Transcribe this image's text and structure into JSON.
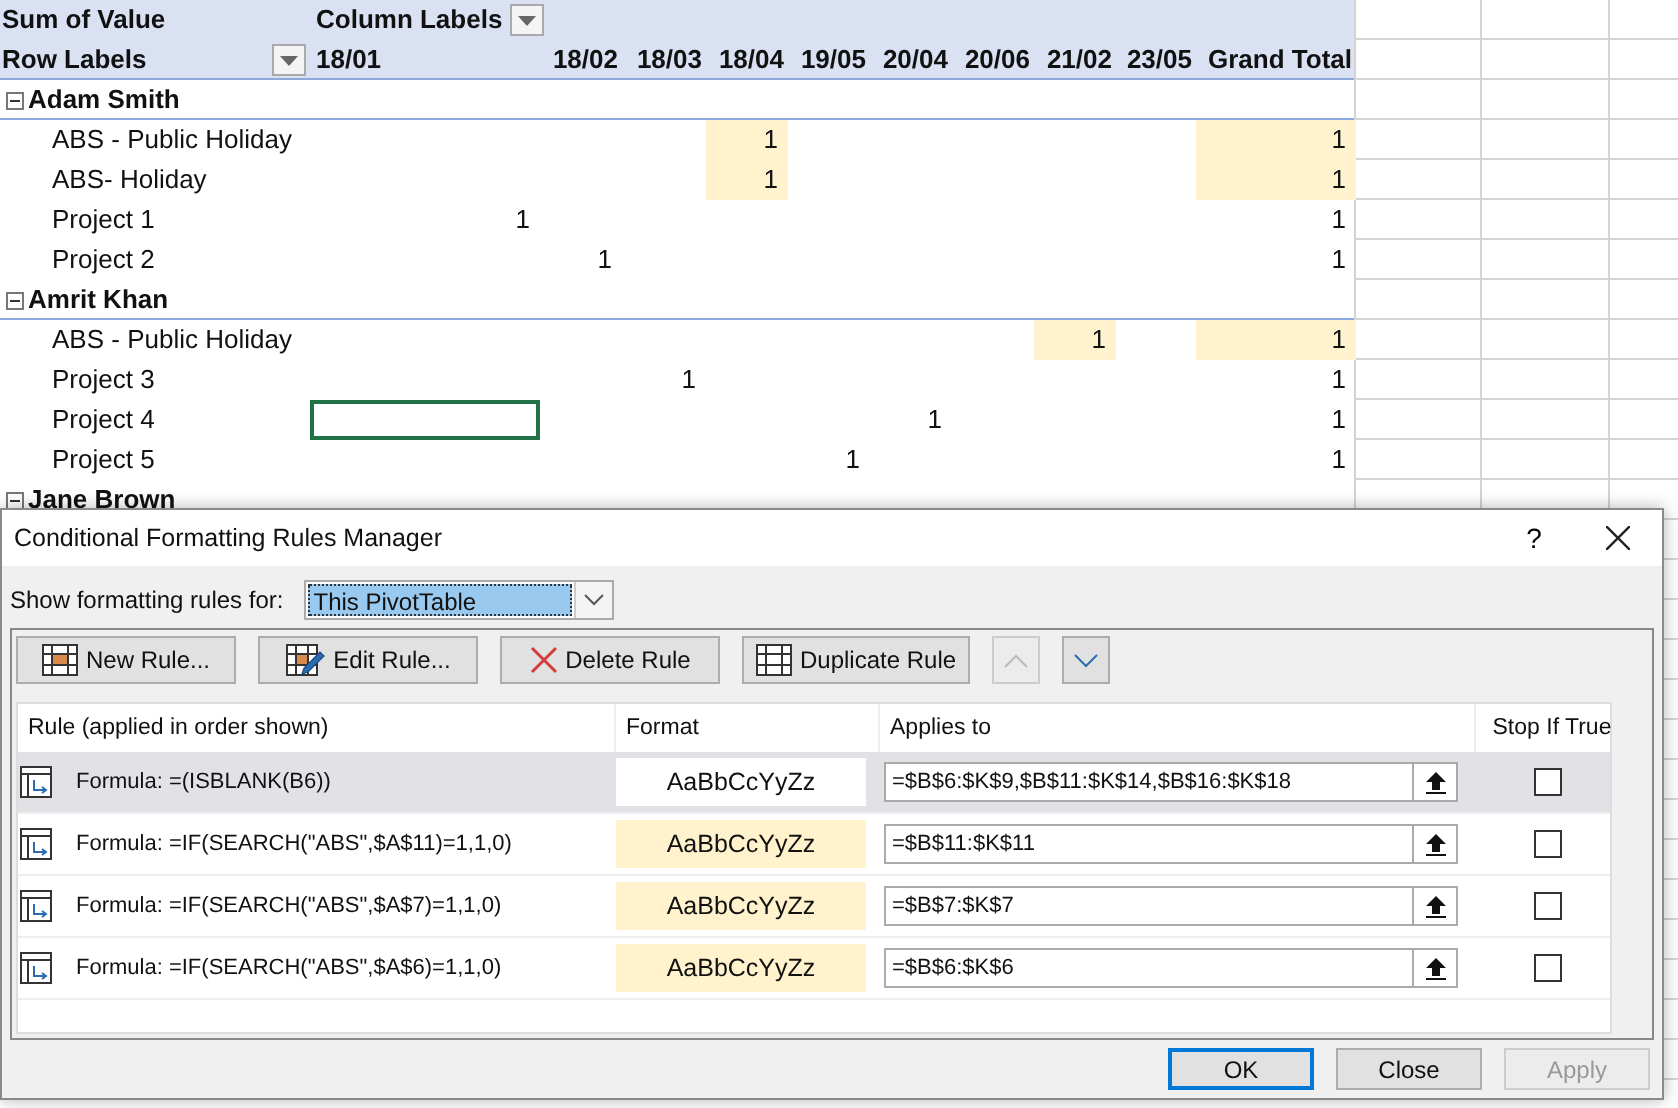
{
  "pivot": {
    "value_label": "Sum of Value",
    "column_labels": "Column Labels",
    "row_labels": "Row Labels",
    "columns": [
      "18/01",
      "18/02",
      "18/03",
      "18/04",
      "19/05",
      "20/04",
      "20/06",
      "21/02",
      "23/05",
      "Grand Total"
    ],
    "groups": [
      {
        "name": "Adam Smith",
        "expanded": true,
        "rows": [
          {
            "label": "ABS - Public Holiday",
            "cells": [
              {
                "selected": false,
                "highlighted": false
              },
              {
                "selected": false,
                "highlighted": false
              },
              {
                "selected": false,
                "highlighted": false
              },
              {
                "value": "1",
                "selected": false,
                "highlighted": true
              },
              {
                "selected": false,
                "highlighted": false
              },
              {
                "selected": false,
                "highlighted": false
              },
              {
                "selected": false,
                "highlighted": false
              },
              {
                "selected": false,
                "highlighted": false
              },
              {
                "selected": false,
                "highlighted": false
              },
              {
                "value": "1",
                "selected": false,
                "highlighted": true
              }
            ]
          },
          {
            "label": "ABS- Holiday",
            "cells": [
              {
                "selected": false,
                "highlighted": false
              },
              {
                "selected": false,
                "highlighted": false
              },
              {
                "selected": false,
                "highlighted": false
              },
              {
                "value": "1",
                "selected": false,
                "highlighted": true
              },
              {
                "selected": false,
                "highlighted": false
              },
              {
                "selected": false,
                "highlighted": false
              },
              {
                "selected": false,
                "highlighted": false
              },
              {
                "selected": false,
                "highlighted": false
              },
              {
                "selected": false,
                "highlighted": false
              },
              {
                "value": "1",
                "selected": false,
                "highlighted": true
              }
            ]
          },
          {
            "label": "Project 1",
            "cells": [
              {
                "value": "1",
                "selected": false,
                "highlighted": false
              },
              {
                "selected": false,
                "highlighted": false
              },
              {
                "selected": false,
                "highlighted": false
              },
              {
                "selected": false,
                "highlighted": false
              },
              {
                "selected": false,
                "highlighted": false
              },
              {
                "selected": false,
                "highlighted": false
              },
              {
                "selected": false,
                "highlighted": false
              },
              {
                "selected": false,
                "highlighted": false
              },
              {
                "selected": false,
                "highlighted": false
              },
              {
                "value": "1",
                "selected": false,
                "highlighted": false
              }
            ]
          },
          {
            "label": "Project 2",
            "cells": [
              {
                "selected": false,
                "highlighted": false
              },
              {
                "value": "1",
                "selected": false,
                "highlighted": false
              },
              {
                "selected": false,
                "highlighted": false
              },
              {
                "selected": false,
                "highlighted": false
              },
              {
                "selected": false,
                "highlighted": false
              },
              {
                "selected": false,
                "highlighted": false
              },
              {
                "selected": false,
                "highlighted": false
              },
              {
                "selected": false,
                "highlighted": false
              },
              {
                "selected": false,
                "highlighted": false
              },
              {
                "value": "1",
                "selected": false,
                "highlighted": false
              }
            ]
          }
        ]
      },
      {
        "name": "Amrit Khan",
        "expanded": true,
        "rows": [
          {
            "label": "ABS - Public Holiday",
            "cells": [
              {
                "selected": false,
                "highlighted": false
              },
              {
                "selected": false,
                "highlighted": false
              },
              {
                "selected": false,
                "highlighted": false
              },
              {
                "selected": false,
                "highlighted": false
              },
              {
                "selected": false,
                "highlighted": false
              },
              {
                "selected": false,
                "highlighted": false
              },
              {
                "selected": false,
                "highlighted": false
              },
              {
                "value": "1",
                "selected": false,
                "highlighted": true
              },
              {
                "selected": false,
                "highlighted": false
              },
              {
                "value": "1",
                "selected": false,
                "highlighted": true
              }
            ]
          },
          {
            "label": "Project 3",
            "cells": [
              {
                "selected": false,
                "highlighted": false
              },
              {
                "selected": false,
                "highlighted": false
              },
              {
                "value": "1",
                "selected": false,
                "highlighted": false
              },
              {
                "selected": false,
                "highlighted": false
              },
              {
                "selected": false,
                "highlighted": false
              },
              {
                "selected": false,
                "highlighted": false
              },
              {
                "selected": false,
                "highlighted": false
              },
              {
                "selected": false,
                "highlighted": false
              },
              {
                "selected": false,
                "highlighted": false
              },
              {
                "value": "1",
                "selected": false,
                "highlighted": false
              }
            ]
          },
          {
            "label": "Project 4",
            "cells": [
              {
                "selected": true,
                "highlighted": false
              },
              {
                "selected": false,
                "highlighted": false
              },
              {
                "selected": false,
                "highlighted": false
              },
              {
                "selected": false,
                "highlighted": false
              },
              {
                "selected": false,
                "highlighted": false
              },
              {
                "value": "1",
                "selected": false,
                "highlighted": false
              },
              {
                "selected": false,
                "highlighted": false
              },
              {
                "selected": false,
                "highlighted": false
              },
              {
                "selected": false,
                "highlighted": false
              },
              {
                "value": "1",
                "selected": false,
                "highlighted": false
              }
            ]
          },
          {
            "label": "Project 5",
            "cells": [
              {
                "selected": false,
                "highlighted": false
              },
              {
                "selected": false,
                "highlighted": false
              },
              {
                "selected": false,
                "highlighted": false
              },
              {
                "selected": false,
                "highlighted": false
              },
              {
                "value": "1",
                "selected": false,
                "highlighted": false
              },
              {
                "selected": false,
                "highlighted": false
              },
              {
                "selected": false,
                "highlighted": false
              },
              {
                "selected": false,
                "highlighted": false
              },
              {
                "selected": false,
                "highlighted": false
              },
              {
                "value": "1",
                "selected": false,
                "highlighted": false
              }
            ]
          }
        ]
      },
      {
        "name": "Jane Brown",
        "expanded": true
      }
    ]
  },
  "dialog": {
    "title": "Conditional Formatting Rules Manager",
    "help": "?",
    "show_for_label": "Show formatting rules for:",
    "show_for_value": "This PivotTable",
    "toolbar": [
      {
        "kind": "new",
        "label": "New Rule...",
        "disabled": false
      },
      {
        "kind": "edit",
        "label": "Edit Rule...",
        "disabled": false
      },
      {
        "kind": "delete",
        "label": "Delete Rule",
        "disabled": false
      },
      {
        "kind": "duplicate",
        "label": "Duplicate Rule",
        "disabled": false
      },
      {
        "kind": "up",
        "disabled": true
      },
      {
        "kind": "down",
        "disabled": false
      }
    ],
    "columns": [
      "Rule (applied in order shown)",
      "Format",
      "Applies to",
      "Stop If True"
    ],
    "rules": [
      {
        "rule": "Formula: =(ISBLANK(B6))",
        "preview": "AaBbCcYyZz",
        "color": "#ffffff",
        "applies_to": "=$B$6:$K$9,$B$11:$K$14,$B$16:$K$18",
        "stop_if_true": false,
        "selected": true
      },
      {
        "rule": "Formula: =IF(SEARCH(\"ABS\",$A$11)=1,1,0)",
        "preview": "AaBbCcYyZz",
        "color": "#fff2cc",
        "applies_to": "=$B$11:$K$11",
        "stop_if_true": false,
        "selected": false
      },
      {
        "rule": "Formula: =IF(SEARCH(\"ABS\",$A$7)=1,1,0)",
        "preview": "AaBbCcYyZz",
        "color": "#fff2cc",
        "applies_to": "=$B$7:$K$7",
        "stop_if_true": false,
        "selected": false
      },
      {
        "rule": "Formula: =IF(SEARCH(\"ABS\",$A$6)=1,1,0)",
        "preview": "AaBbCcYyZz",
        "color": "#fff2cc",
        "applies_to": "=$B$6:$K$6",
        "stop_if_true": false,
        "selected": false
      }
    ],
    "buttons": [
      {
        "label": "OK",
        "default": true,
        "disabled": false
      },
      {
        "label": "Close",
        "default": false,
        "disabled": false
      },
      {
        "label": "Apply",
        "default": false,
        "disabled": true
      }
    ]
  }
}
